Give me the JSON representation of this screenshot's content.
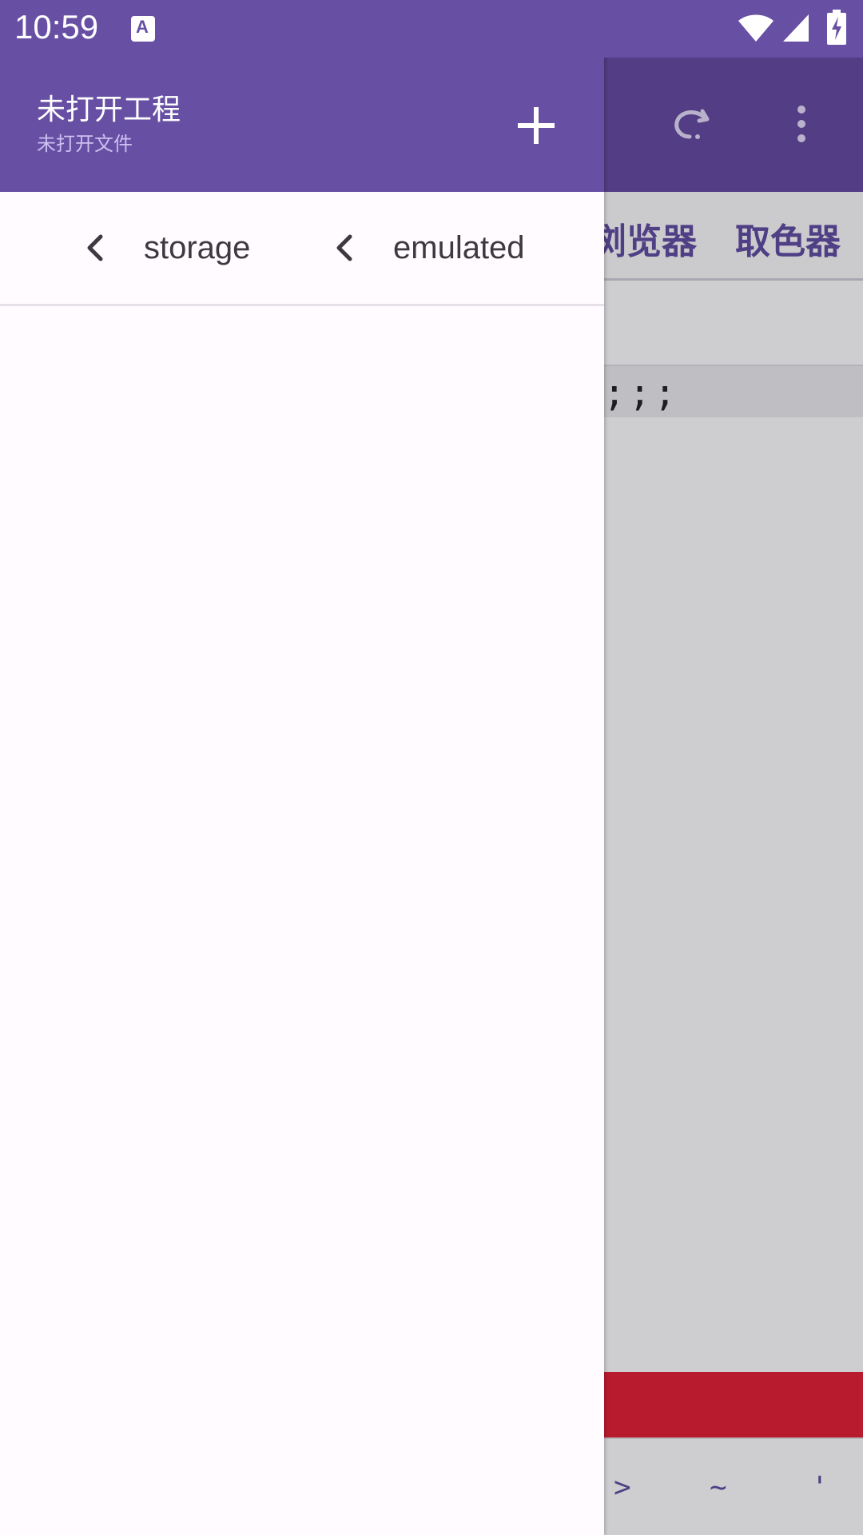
{
  "status_bar": {
    "time": "10:59",
    "icons": [
      "a-keyboard-icon",
      "wifi-icon",
      "signal-icon",
      "battery-charging-icon"
    ]
  },
  "drawer": {
    "title": "未打开工程",
    "subtitle": "未打开文件",
    "add_icon": "plus-icon",
    "breadcrumbs": [
      {
        "label": "storage",
        "icon": "chevron-left-icon"
      },
      {
        "label": "emulated",
        "icon": "chevron-left-icon"
      }
    ]
  },
  "background_app": {
    "toolbar_icons": [
      "redo-icon",
      "more-vert-icon"
    ],
    "tabs": [
      "浏览器",
      "取色器"
    ],
    "editor_line": ";;;",
    "symbol_keys": [
      ">",
      "~",
      "'"
    ]
  },
  "colors": {
    "primary": "#6750a4",
    "drawer_surface": "#fffbfe",
    "error_bar": "#b81a2e"
  }
}
